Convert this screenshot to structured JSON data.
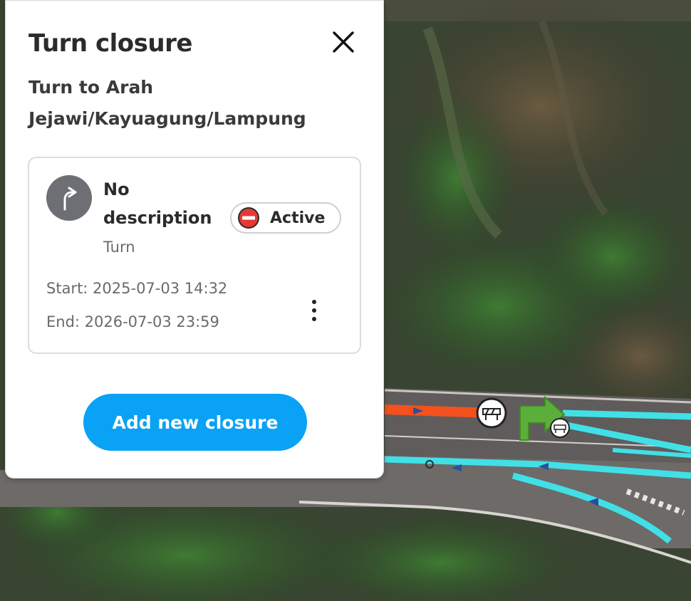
{
  "panel": {
    "title": "Turn closure",
    "close_icon": "close-icon",
    "subtitle": "Turn to Arah Jejawi/Kayuagung/Lampung",
    "card": {
      "icon": "turn-right-arrow-icon",
      "description": "No description",
      "type": "Turn",
      "status": {
        "label": "Active",
        "icon": "no-entry-icon",
        "color": "#e53935"
      },
      "start": "Start: 2025-07-03 14:32",
      "end": "End: 2026-07-03 23:59",
      "more_icon": "more-vertical-icon"
    },
    "add_button": "Add new closure"
  },
  "map": {
    "closed_segment_color": "#f4511e",
    "road_highlight_color": "#40e0e6",
    "turn_arrow_color": "#5cae3a",
    "closure_marker_icon": "road-barrier-icon"
  },
  "colors": {
    "accent": "#0aa2f5",
    "panel_bg": "#ffffff"
  }
}
